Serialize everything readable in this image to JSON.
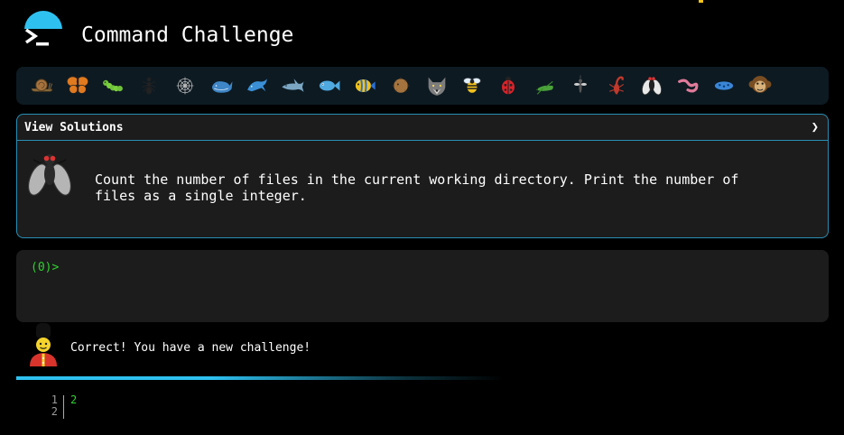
{
  "header": {
    "title": "Command Challenge",
    "accent": "#2ec1f0"
  },
  "animals": [
    {
      "name": "snail-icon"
    },
    {
      "name": "butterfly-icon"
    },
    {
      "name": "caterpillar-icon"
    },
    {
      "name": "ant-icon"
    },
    {
      "name": "spider-web-icon"
    },
    {
      "name": "whale-icon"
    },
    {
      "name": "dolphin-icon"
    },
    {
      "name": "shark-icon"
    },
    {
      "name": "fish-icon"
    },
    {
      "name": "tropical-fish-icon"
    },
    {
      "name": "blowfish-icon"
    },
    {
      "name": "wolf-icon"
    },
    {
      "name": "bee-icon"
    },
    {
      "name": "ladybug-icon"
    },
    {
      "name": "cricket-icon"
    },
    {
      "name": "mosquito-icon"
    },
    {
      "name": "scorpion-icon"
    },
    {
      "name": "fly-icon"
    },
    {
      "name": "worm-icon"
    },
    {
      "name": "microbe-icon"
    },
    {
      "name": "monkey-icon"
    }
  ],
  "challenge": {
    "header_label": "View Solutions",
    "chevron": "❯",
    "text": "Count the number of files in the current working directory. Print the number of\nfiles as a single integer.",
    "border_color": "#2a8fb5"
  },
  "terminal": {
    "prompt": "(0)>",
    "input_value": "",
    "prompt_color": "#2fd12f"
  },
  "status": {
    "message": "Correct! You have a new challenge!",
    "progress_fraction": 0.4
  },
  "output": {
    "line_numbers": [
      "1",
      "2"
    ],
    "lines": [
      "2",
      ""
    ]
  }
}
